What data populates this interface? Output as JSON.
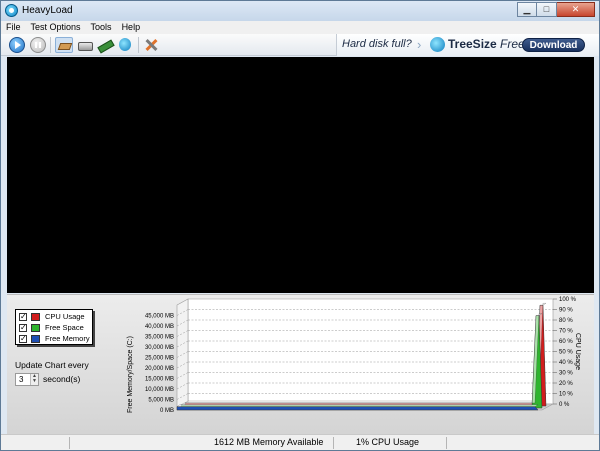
{
  "window": {
    "title": "HeavyLoad"
  },
  "menu": [
    "File",
    "Test Options",
    "Tools",
    "Help"
  ],
  "toolbar": {
    "buttons": [
      "start-icon",
      "pause-icon",
      "cpu-icon",
      "disk-icon",
      "memory-icon",
      "treesize-icon",
      "tools-icon"
    ]
  },
  "ad": {
    "question": "Hard disk full?",
    "brand_bold": "TreeSize",
    "brand_italic": "Free",
    "download": "Download"
  },
  "legend": [
    {
      "label": "CPU Usage",
      "color": "#d11d1d",
      "checked": "✓"
    },
    {
      "label": "Free Space",
      "color": "#2fb52f",
      "checked": "✓"
    },
    {
      "label": "Free Memory",
      "color": "#1f4fb3",
      "checked": "✓"
    }
  ],
  "update": {
    "label": "Update Chart every",
    "value": "3",
    "unit": "second(s)"
  },
  "chart_data": {
    "type": "area",
    "left_axis_title": "Free Memory/Space (C:)",
    "right_axis_title": "CPU Usage",
    "left_ticks": [
      "0 MB",
      "5,000 MB",
      "10,000 MB",
      "15,000 MB",
      "20,000 MB",
      "25,000 MB",
      "30,000 MB",
      "35,000 MB",
      "40,000 MB",
      "45,000 MB"
    ],
    "right_ticks": [
      "0 %",
      "10 %",
      "20 %",
      "30 %",
      "40 %",
      "50 %",
      "60 %",
      "70 %",
      "80 %",
      "90 %",
      "100 %"
    ],
    "ylim_left": [
      0,
      50000
    ],
    "ylim_right": [
      0,
      100
    ],
    "grid": true,
    "series": [
      {
        "name": "CPU Usage",
        "color": "#d11d1d",
        "unit": "%",
        "baseline": 1,
        "peak": 96
      },
      {
        "name": "Free Space",
        "color": "#2fb52f",
        "unit": "MB",
        "baseline": 0,
        "peak": 44000
      },
      {
        "name": "Free Memory",
        "color": "#1f4fb3",
        "unit": "MB",
        "baseline": 1612,
        "peak": 1612
      }
    ]
  },
  "status": {
    "memory": "1612 MB Memory Available",
    "cpu": "1% CPU Usage"
  }
}
